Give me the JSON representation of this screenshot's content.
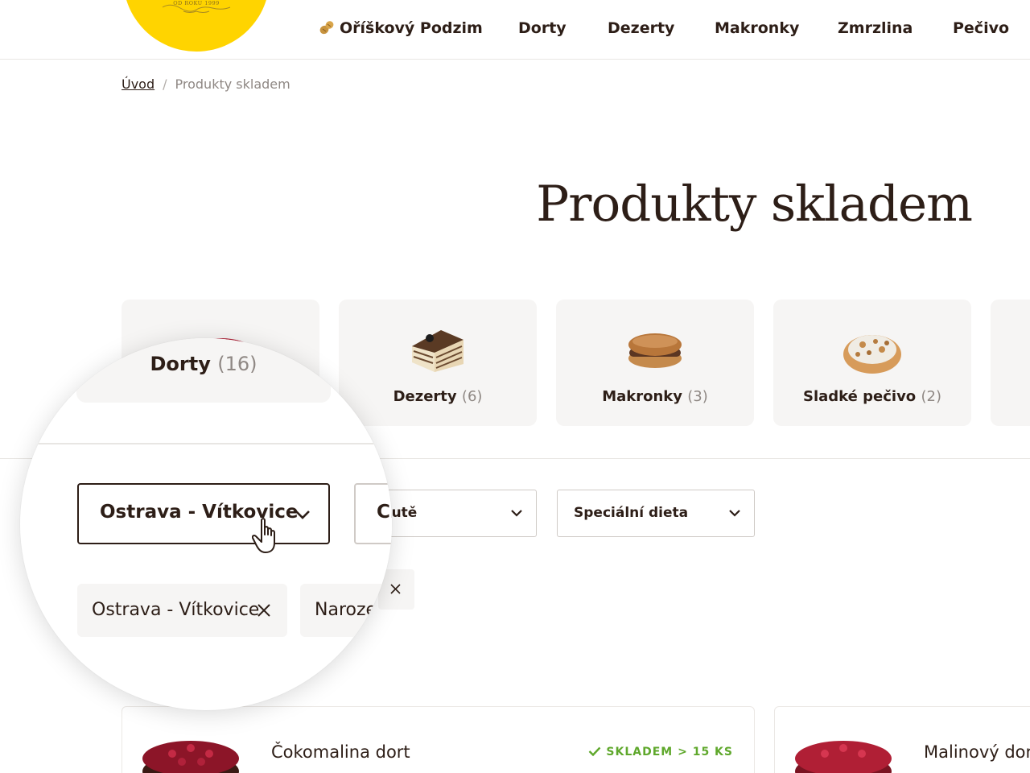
{
  "header": {
    "logo_tagline": "OD ROKU 1999",
    "nav": [
      {
        "label": "Oříškový Podzim",
        "icon": "peanut-icon"
      },
      {
        "label": "Dorty"
      },
      {
        "label": "Dezerty"
      },
      {
        "label": "Makronky"
      },
      {
        "label": "Zmrzlina"
      },
      {
        "label": "Pečivo"
      }
    ]
  },
  "breadcrumb": {
    "home": "Úvod",
    "separator": "/",
    "current": "Produkty skladem"
  },
  "page": {
    "title": "Produkty skladem"
  },
  "categories": [
    {
      "label": "Dorty",
      "count": "(16)"
    },
    {
      "label": "Dezerty",
      "count": "(6)"
    },
    {
      "label": "Makronky",
      "count": "(3)"
    },
    {
      "label": "Sladké pečivo",
      "count": "(2)"
    }
  ],
  "filters": {
    "store": {
      "value": "Ostrava - Vítkovice"
    },
    "occasion": {
      "value": "Chutě"
    },
    "diet": {
      "value": "Speciální dieta"
    }
  },
  "active_filters": [
    {
      "label": "Ostrava - Vítkovice"
    },
    {
      "label": "Naroze"
    }
  ],
  "products": [
    {
      "name": "Čokomalina dort",
      "stock": "SKLADEM > 15 KS"
    },
    {
      "name": "Malinový dort",
      "stock": ""
    }
  ],
  "colors": {
    "brand_yellow": "#ffd400",
    "text_dark": "#2d1e17",
    "stock_green": "#5fa82c",
    "card_bg": "#f6f5f4"
  }
}
